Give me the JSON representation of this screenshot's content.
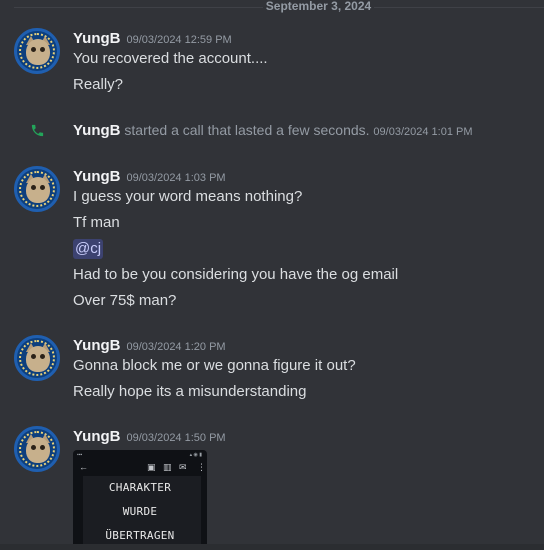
{
  "date_divider": "September 3, 2024",
  "groups": [
    {
      "username": "YungB",
      "timestamp": "09/03/2024 12:59 PM",
      "lines": [
        "You recovered the account....",
        "Really?"
      ]
    },
    {
      "username": "YungB",
      "timestamp": "09/03/2024 1:03 PM",
      "lines": [
        "I guess your word means nothing?",
        "Tf man",
        "@cj",
        "Had to be you considering you have the og email",
        "Over 75$ man?"
      ]
    },
    {
      "username": "YungB",
      "timestamp": "09/03/2024 1:20 PM",
      "lines": [
        "Gonna block me or we gonna figure it out?",
        "Really hope its a misunderstanding"
      ]
    },
    {
      "username": "YungB",
      "timestamp": "09/03/2024 1:50 PM",
      "attachment": {
        "lines": [
          "CHARAKTER",
          "WURDE",
          "ÜBERTRAGEN"
        ]
      }
    }
  ],
  "system_call": {
    "username": "YungB",
    "text": "started a call that lasted a few seconds.",
    "timestamp": "09/03/2024 1:01 PM",
    "icon": "phone-icon",
    "icon_color": "#23a55a"
  },
  "colors": {
    "background": "#313338",
    "mention_bg": "#3c4270",
    "mention_text": "#c9cdfb"
  }
}
